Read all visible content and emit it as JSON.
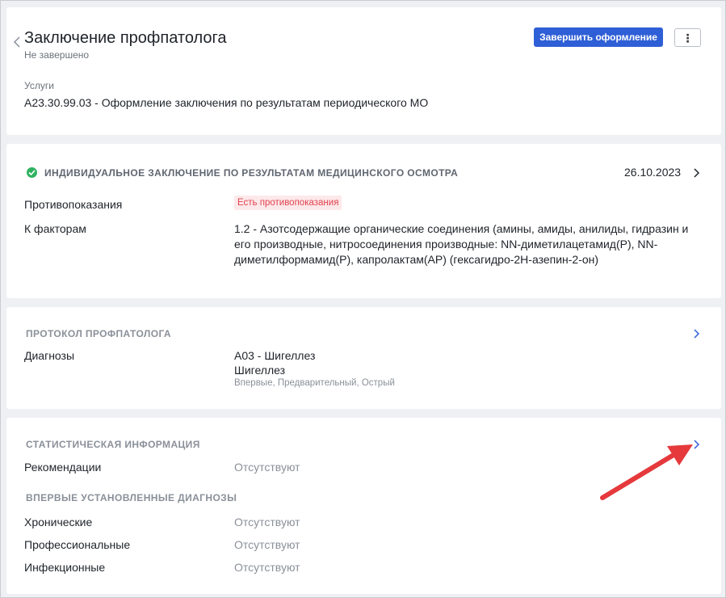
{
  "header": {
    "title": "Заключение профпатолога",
    "status": "Не завершено",
    "finish_button": "Завершить оформление",
    "more_button": "⋮",
    "services_label": "Услуги",
    "services_value": "A23.30.99.03 - Оформление заключения по результатам периодического МО"
  },
  "individual": {
    "title": "ИНДИВИДУАЛЬНОЕ ЗАКЛЮЧЕНИЕ ПО РЕЗУЛЬТАТАМ МЕДИЦИНСКОГО ОСМОТРА",
    "date": "26.10.2023",
    "contraindications_label": "Противопоказания",
    "contraindications_badge": "Есть противопоказания",
    "factors_label": "К факторам",
    "factors_value": "1.2 - Азотсодержащие органические соединения (амины, амиды, анилиды, гидразин и его производные, нитросоединения производные: NN-диметилацетамид(Р), NN-диметилформамид(Р), капролактам(АР) (гексагидро-2Н-азепин-2-он)"
  },
  "protocol": {
    "title": "ПРОТОКОЛ ПРОФПАТОЛОГА",
    "diagnoses_label": "Диагнозы",
    "diagnosis_code": "A03 - Шигеллез",
    "diagnosis_name": "Шигеллез",
    "diagnosis_tags": "Впервые, Предварительный, Острый"
  },
  "statistics": {
    "title": "СТАТИСТИЧЕСКАЯ ИНФОРМАЦИЯ",
    "recommendations_label": "Рекомендации",
    "recommendations_value": "Отсутствуют",
    "new_diagnoses_title": "ВПЕРВЫЕ УСТАНОВЛЕННЫЕ ДИАГНОЗЫ",
    "chronic_label": "Хронические",
    "chronic_value": "Отсутствуют",
    "professional_label": "Профессиональные",
    "professional_value": "Отсутствуют",
    "infectious_label": "Инфекционные",
    "infectious_value": "Отсутствуют"
  },
  "colors": {
    "primary": "#2f5fd6",
    "success": "#2fb260",
    "danger_text": "#e0434f",
    "danger_bg": "#fde8ea",
    "annotation_arrow": "#e5393c"
  },
  "icons": {
    "back": "chevron-left-icon",
    "status_ok": "check-circle-icon",
    "open": "chevron-right-icon",
    "annotation": "red-arrow-icon"
  }
}
